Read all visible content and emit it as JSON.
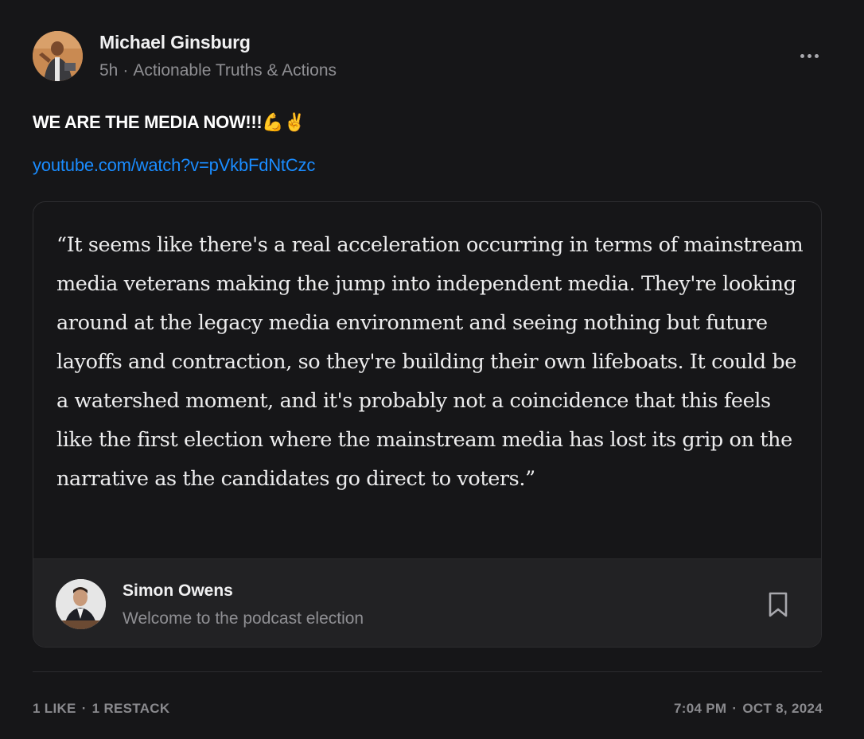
{
  "post": {
    "author": "Michael Ginsburg",
    "time": "5h",
    "separator": "·",
    "community": "Actionable Truths & Actions",
    "text": "WE ARE THE MEDIA NOW!!!💪✌️",
    "link": "youtube.com/watch?v=pVkbFdNtCzc"
  },
  "card": {
    "quote": "“It seems like there's a real acceleration occurring in terms of mainstream media veterans making the jump into independent media. They're looking around at the legacy media environment and seeing nothing but future layoffs and contraction, so they're building their own lifeboats. It could be a watershed moment, and it's probably not a coincidence that this feels like the first election where the mainstream media has lost its grip on the narrative as the candidates go direct to voters.”",
    "source_author": "Simon Owens",
    "source_title": "Welcome to the podcast election"
  },
  "footer": {
    "likes": "1 LIKE",
    "restacks": "1 RESTACK",
    "separator": "·",
    "time": "7:04 PM",
    "date": "OCT 8, 2024"
  },
  "icons": {
    "more": "more-horizontal-icon",
    "bookmark": "bookmark-icon"
  },
  "colors": {
    "background": "#161618",
    "link": "#1a8cff",
    "muted": "#8f8f93",
    "card_footer": "#222224"
  }
}
